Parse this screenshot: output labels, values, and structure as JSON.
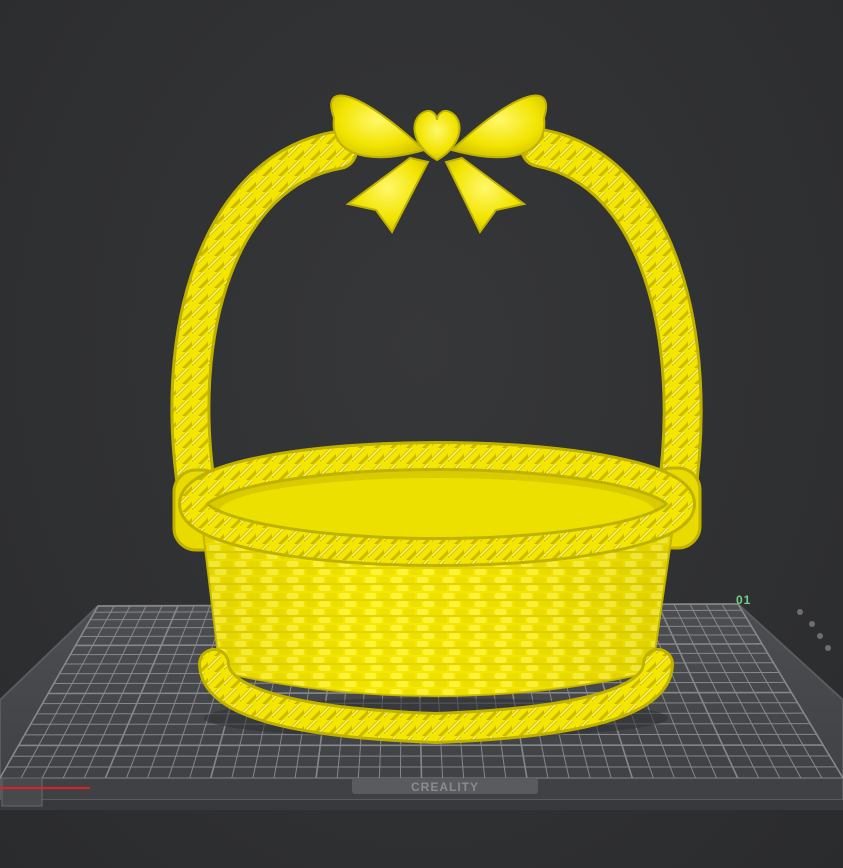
{
  "viewport": {
    "bed_brand_label": "CREALITY",
    "bed_corner_label": "01"
  },
  "model": {
    "color": "#f2e400",
    "shade_color": "#c9bb00",
    "highlight_color": "#fffb7a"
  },
  "bed": {
    "surface_color": "#4a4b4e",
    "grid_color": "#8e8f93",
    "frame_color": "#3a3b3e"
  },
  "axes": {
    "x_color": "#e02020",
    "y_color": "#20c040"
  }
}
